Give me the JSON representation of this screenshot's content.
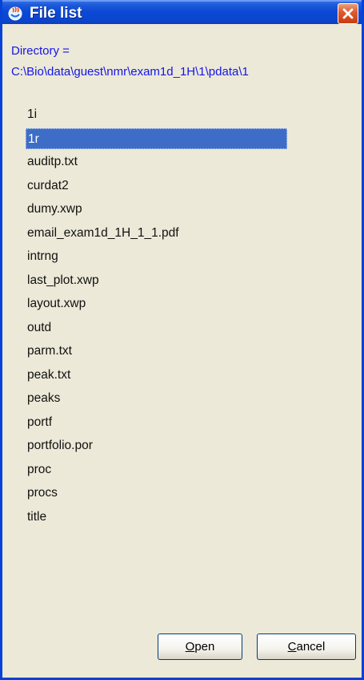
{
  "window": {
    "title": "File list"
  },
  "directory": {
    "label": "Directory =",
    "path": "C:\\Bio\\data\\guest\\nmr\\exam1d_1H\\1\\pdata\\1"
  },
  "files": [
    {
      "name": "1i",
      "selected": false
    },
    {
      "name": "1r",
      "selected": true
    },
    {
      "name": "auditp.txt",
      "selected": false
    },
    {
      "name": "curdat2",
      "selected": false
    },
    {
      "name": "dumy.xwp",
      "selected": false
    },
    {
      "name": "email_exam1d_1H_1_1.pdf",
      "selected": false
    },
    {
      "name": "intrng",
      "selected": false
    },
    {
      "name": "last_plot.xwp",
      "selected": false
    },
    {
      "name": "layout.xwp",
      "selected": false
    },
    {
      "name": "outd",
      "selected": false
    },
    {
      "name": "parm.txt",
      "selected": false
    },
    {
      "name": "peak.txt",
      "selected": false
    },
    {
      "name": "peaks",
      "selected": false
    },
    {
      "name": "portf",
      "selected": false
    },
    {
      "name": "portfolio.por",
      "selected": false
    },
    {
      "name": "proc",
      "selected": false
    },
    {
      "name": "procs",
      "selected": false
    },
    {
      "name": "title",
      "selected": false
    }
  ],
  "buttons": {
    "open_mnemonic": "O",
    "open_rest": "pen",
    "cancel_mnemonic": "C",
    "cancel_rest": "ancel"
  },
  "colors": {
    "title_bar": "#0a49d6",
    "directory_text": "#1515e8",
    "selection": "#3d6dc7",
    "dialog_bg": "#ece9d8"
  },
  "icons": {
    "app": "java-coffee-icon",
    "close": "close-icon"
  }
}
